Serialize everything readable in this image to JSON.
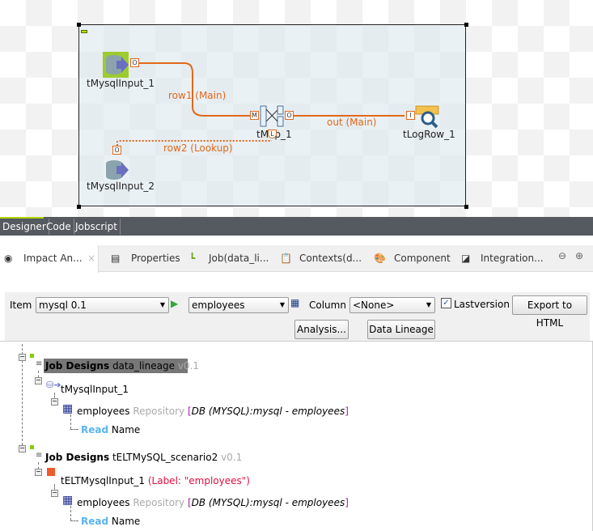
{
  "designer": {
    "components": [
      {
        "name": "tMysqlInput_1",
        "icon": "mysql-input-icon"
      },
      {
        "name": "tMysqlInput_2",
        "icon": "mysql-input-icon"
      },
      {
        "name": "tMap_1",
        "icon": "tmap-icon"
      },
      {
        "name": "tLogRow_1",
        "icon": "logrow-icon"
      }
    ],
    "links": [
      {
        "label": "row1 (Main)",
        "style": "solid"
      },
      {
        "label": "out (Main)",
        "style": "solid"
      },
      {
        "label": "row2 (Lookup)",
        "style": "dotted"
      }
    ],
    "connectors": {
      "out": "O",
      "main": "M",
      "lookup": "L",
      "input": "I"
    },
    "link_color": "#e0691a"
  },
  "editor_tabs": [
    "Designer",
    "Code",
    "Jobscript"
  ],
  "view_tabs": [
    {
      "label": "Impact An...",
      "icon": "eye-icon",
      "active": true
    },
    {
      "label": "Properties",
      "icon": "properties-icon"
    },
    {
      "label": "Job(data_li...",
      "icon": "job-icon"
    },
    {
      "label": "Contexts(d...",
      "icon": "contexts-icon"
    },
    {
      "label": "Component",
      "icon": "palette-icon"
    },
    {
      "label": "Integration...",
      "icon": "integration-icon"
    }
  ],
  "toolbar": {
    "item_label": "Item",
    "item_value": "mysql 0.1",
    "table_value": "employees",
    "column_label": "Column",
    "column_value": "<None>",
    "lastversion_label": "Lastversion",
    "lastversion_checked": true,
    "export_label": "Export to HTML",
    "analysis_label": "Analysis...",
    "lineage_label": "Data Lineage"
  },
  "tree": [
    {
      "prefix": "Job Designs",
      "name": "data_lineage",
      "version": "v0.1",
      "component": "tMysqlInput_1",
      "component_label": "",
      "table": "employees",
      "repo": "Repository",
      "repo_path": "DB (MYSQL):mysql - employees",
      "access": "Read",
      "column": "Name"
    },
    {
      "prefix": "Job Designs",
      "name": "tELTMySQL_scenario2",
      "version": "v0.1",
      "component": "tELTMysqlInput_1",
      "component_label": "(Label: \"employees\")",
      "table": "employees",
      "repo": "Repository",
      "repo_path": "DB (MYSQL):mysql - employees",
      "access": "Read",
      "column": "Name"
    }
  ]
}
